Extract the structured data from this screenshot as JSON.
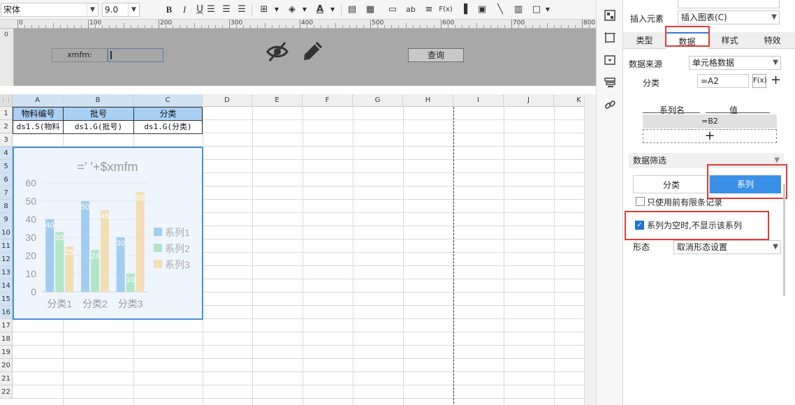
{
  "toolbar": {
    "font_name": "宋体",
    "font_size": "9.0",
    "buttons": [
      "bold",
      "italic",
      "underline",
      "align-left",
      "align-center",
      "align-right",
      "border",
      "fill-color",
      "font-color",
      "merge",
      "table",
      "cell-format",
      "text",
      "text-wrap",
      "formula",
      "chart",
      "image",
      "slash",
      "sub-report",
      "frame"
    ]
  },
  "ruler": {
    "labels": [
      "0",
      "100",
      "200",
      "300",
      "400",
      "500",
      "600",
      "700",
      "800"
    ],
    "vlabel": "0"
  },
  "param_pane": {
    "label": "xmfm:",
    "input_value": "",
    "query_button": "查询"
  },
  "grid": {
    "corner": "",
    "columns": [
      "A",
      "B",
      "C",
      "D",
      "E",
      "F",
      "G",
      "H",
      "I",
      "J",
      "K"
    ],
    "rows": [
      "1",
      "2",
      "3",
      "4",
      "5",
      "6",
      "7",
      "8",
      "9",
      "10",
      "11",
      "12",
      "13",
      "14",
      "15",
      "16",
      "17",
      "18",
      "19",
      "20",
      "21",
      "22"
    ],
    "headers": {
      "a1": "物料编号",
      "b1": "批号",
      "c1": "分类"
    },
    "data": {
      "a2": "ds1.S(物料",
      "b2": "ds1.G(批号)",
      "c2": "ds1.G(分类)"
    }
  },
  "chart_data": {
    "type": "bar",
    "title": "=' '+$xmfm",
    "categories": [
      "分类1",
      "分类2",
      "分类3"
    ],
    "series": [
      {
        "name": "系列1",
        "values": [
          40,
          50,
          30
        ],
        "color": "#a3cdf0"
      },
      {
        "name": "系列2",
        "values": [
          33,
          23,
          10
        ],
        "color": "#b2e5c8"
      },
      {
        "name": "系列3",
        "values": [
          25,
          45,
          55
        ],
        "color": "#f2ddb5"
      }
    ],
    "data_labels": [
      [
        "40",
        "50",
        "30"
      ],
      [
        "33",
        "23",
        "10"
      ],
      [
        "25",
        "45",
        "55"
      ]
    ],
    "yticks": [
      "0",
      "10",
      "20",
      "30",
      "40",
      "50",
      "60"
    ],
    "ylim": [
      0,
      60
    ],
    "legend": "right",
    "grid": true
  },
  "side_icons": [
    "component-icon",
    "frame-icon",
    "widget-icon",
    "layer-icon",
    "link-icon"
  ],
  "panel": {
    "insert_label": "插入元素",
    "insert_value": "插入图表(C)",
    "tabs": [
      "类型",
      "数据",
      "样式",
      "特效"
    ],
    "active_tab": "数据",
    "source_label": "数据来源",
    "source_value": "单元格数据",
    "category_label": "分类",
    "category_value": "=A2",
    "formula_btn": "F(x)",
    "add_btn": "+",
    "series_name_header": "系列名",
    "value_header": "值",
    "series_value": "=B2",
    "series_add": "+",
    "filter_section": "数据筛选",
    "filter_tab_category": "分类",
    "filter_tab_series": "系列",
    "limit_records_label": "只使用前有限条记录",
    "hide_empty_label": "系列为空时,不显示该系列",
    "shape_label": "形态",
    "shape_value": "取消形态设置",
    "top_label": "",
    "accent": "#3a90e8",
    "highlight": "#e53935"
  }
}
